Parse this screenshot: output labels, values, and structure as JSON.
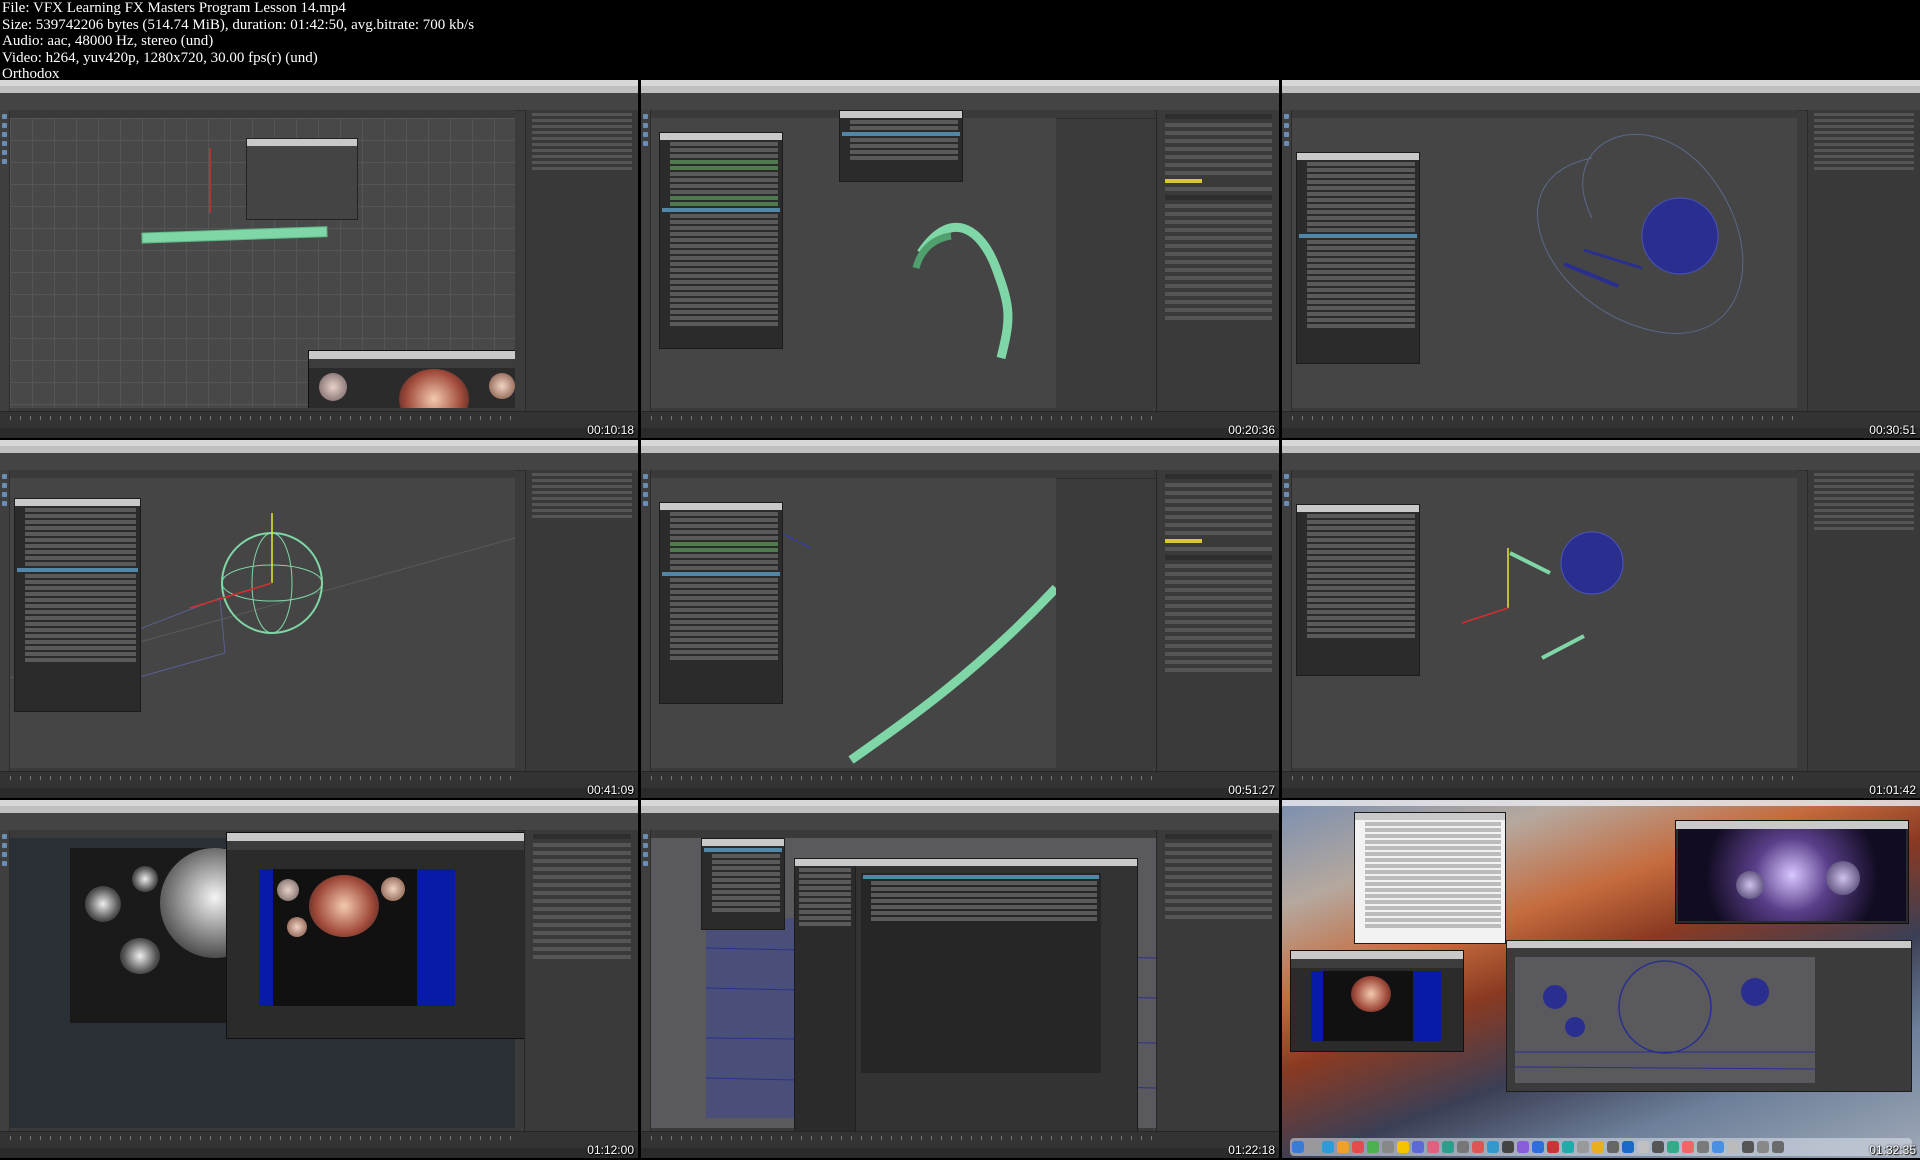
{
  "header": {
    "file_line": "File: VFX Learning FX Masters Program Lesson 14.mp4",
    "size_line": "Size: 539742206 bytes (514.74 MiB), duration: 01:42:50, avg.bitrate: 700 kb/s",
    "audio_line": "Audio: aac, 48000 Hz, stereo (und)",
    "video_line": "Video: h264, yuv420p, 1280x720, 30.00 fps(r) (und)",
    "tag_line": "Orthodox"
  },
  "thumbnails": [
    {
      "timestamp": "00:10:18"
    },
    {
      "timestamp": "00:20:36"
    },
    {
      "timestamp": "00:30:51"
    },
    {
      "timestamp": "00:41:09"
    },
    {
      "timestamp": "00:51:27"
    },
    {
      "timestamp": "01:01:42"
    },
    {
      "timestamp": "01:12:00"
    },
    {
      "timestamp": "01:22:18"
    },
    {
      "timestamp": "01:32:35"
    }
  ],
  "colors": {
    "maya_bg": "#3b3b3b",
    "viewport": "#454545",
    "ribbon_green": "#7fd6a6",
    "sphere_blue": "#2a2f8f",
    "render_blue": "#0a1aa8",
    "selection": "#5286a8",
    "attr_yellow": "#d9c72c"
  },
  "icons": [
    "maya-logo-icon",
    "move-tool-icon",
    "rotate-tool-icon",
    "scale-tool-icon",
    "play-icon",
    "dock-app-icon"
  ]
}
